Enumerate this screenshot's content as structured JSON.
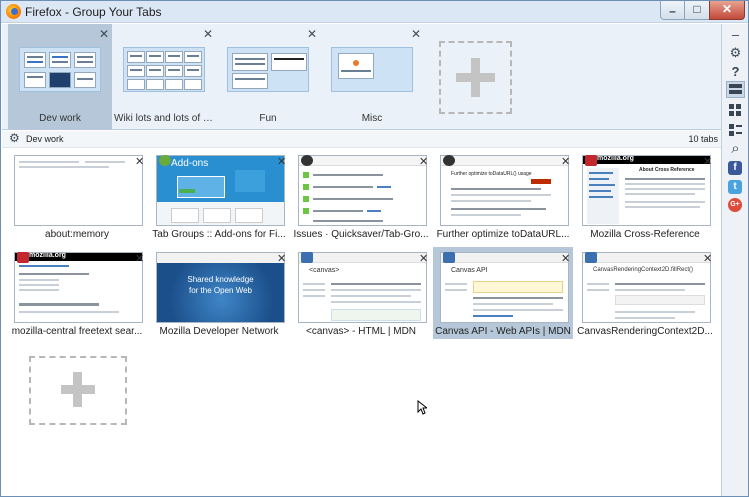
{
  "window": {
    "title": "Firefox - Group Your Tabs",
    "minimize_glyph": "–",
    "maximize_glyph": "□",
    "close_glyph": "✕"
  },
  "groups": [
    {
      "label": "Dev work",
      "close": "✕"
    },
    {
      "label": "Wiki lots and lots of art...",
      "close": "✕"
    },
    {
      "label": "Fun",
      "close": "✕"
    },
    {
      "label": "Misc",
      "close": "✕"
    }
  ],
  "sidebar": {
    "minimize": "–",
    "settings": "⚙",
    "help": "?",
    "search": "⌕",
    "facebook": "f",
    "twitter": "t",
    "googleplus": "G+",
    "colors": {
      "facebook": "#3b5998",
      "twitter": "#4aa3df",
      "googleplus": "#dd4b39"
    }
  },
  "active_group": {
    "name": "Dev work",
    "count": "10 tabs",
    "gear": "⚙"
  },
  "tabs": [
    {
      "label": "about:memory",
      "close": "✕"
    },
    {
      "label": "Tab Groups :: Add-ons for Fi...",
      "close": "✕",
      "thumb_text": "Add-ons"
    },
    {
      "label": "Issues · Quicksaver/Tab-Gro...",
      "close": "✕"
    },
    {
      "label": "Further optimize toDataURL...",
      "close": "✕",
      "thumb_text": "Further optimize toDataURL() usage"
    },
    {
      "label": "Mozilla Cross-Reference",
      "close": "✕",
      "thumb_text": "mozilla.org",
      "thumb_heading": "About Cross Reference"
    },
    {
      "label": "mozilla-central freetext sear...",
      "close": "✕",
      "thumb_text": "mozilla.org"
    },
    {
      "label": "Mozilla Developer Network",
      "close": "✕",
      "thumb_text": "Shared knowledge",
      "thumb_text2": "for the Open Web"
    },
    {
      "label": "<canvas> - HTML | MDN",
      "close": "✕",
      "thumb_text": "<canvas>"
    },
    {
      "label": "Canvas API - Web APIs | MDN",
      "close": "✕",
      "thumb_text": "Canvas API"
    },
    {
      "label": "CanvasRenderingContext2D...",
      "close": "✕",
      "thumb_text": "CanvasRenderingContext2D.fillRect()"
    }
  ],
  "selected_tab_index": 8
}
